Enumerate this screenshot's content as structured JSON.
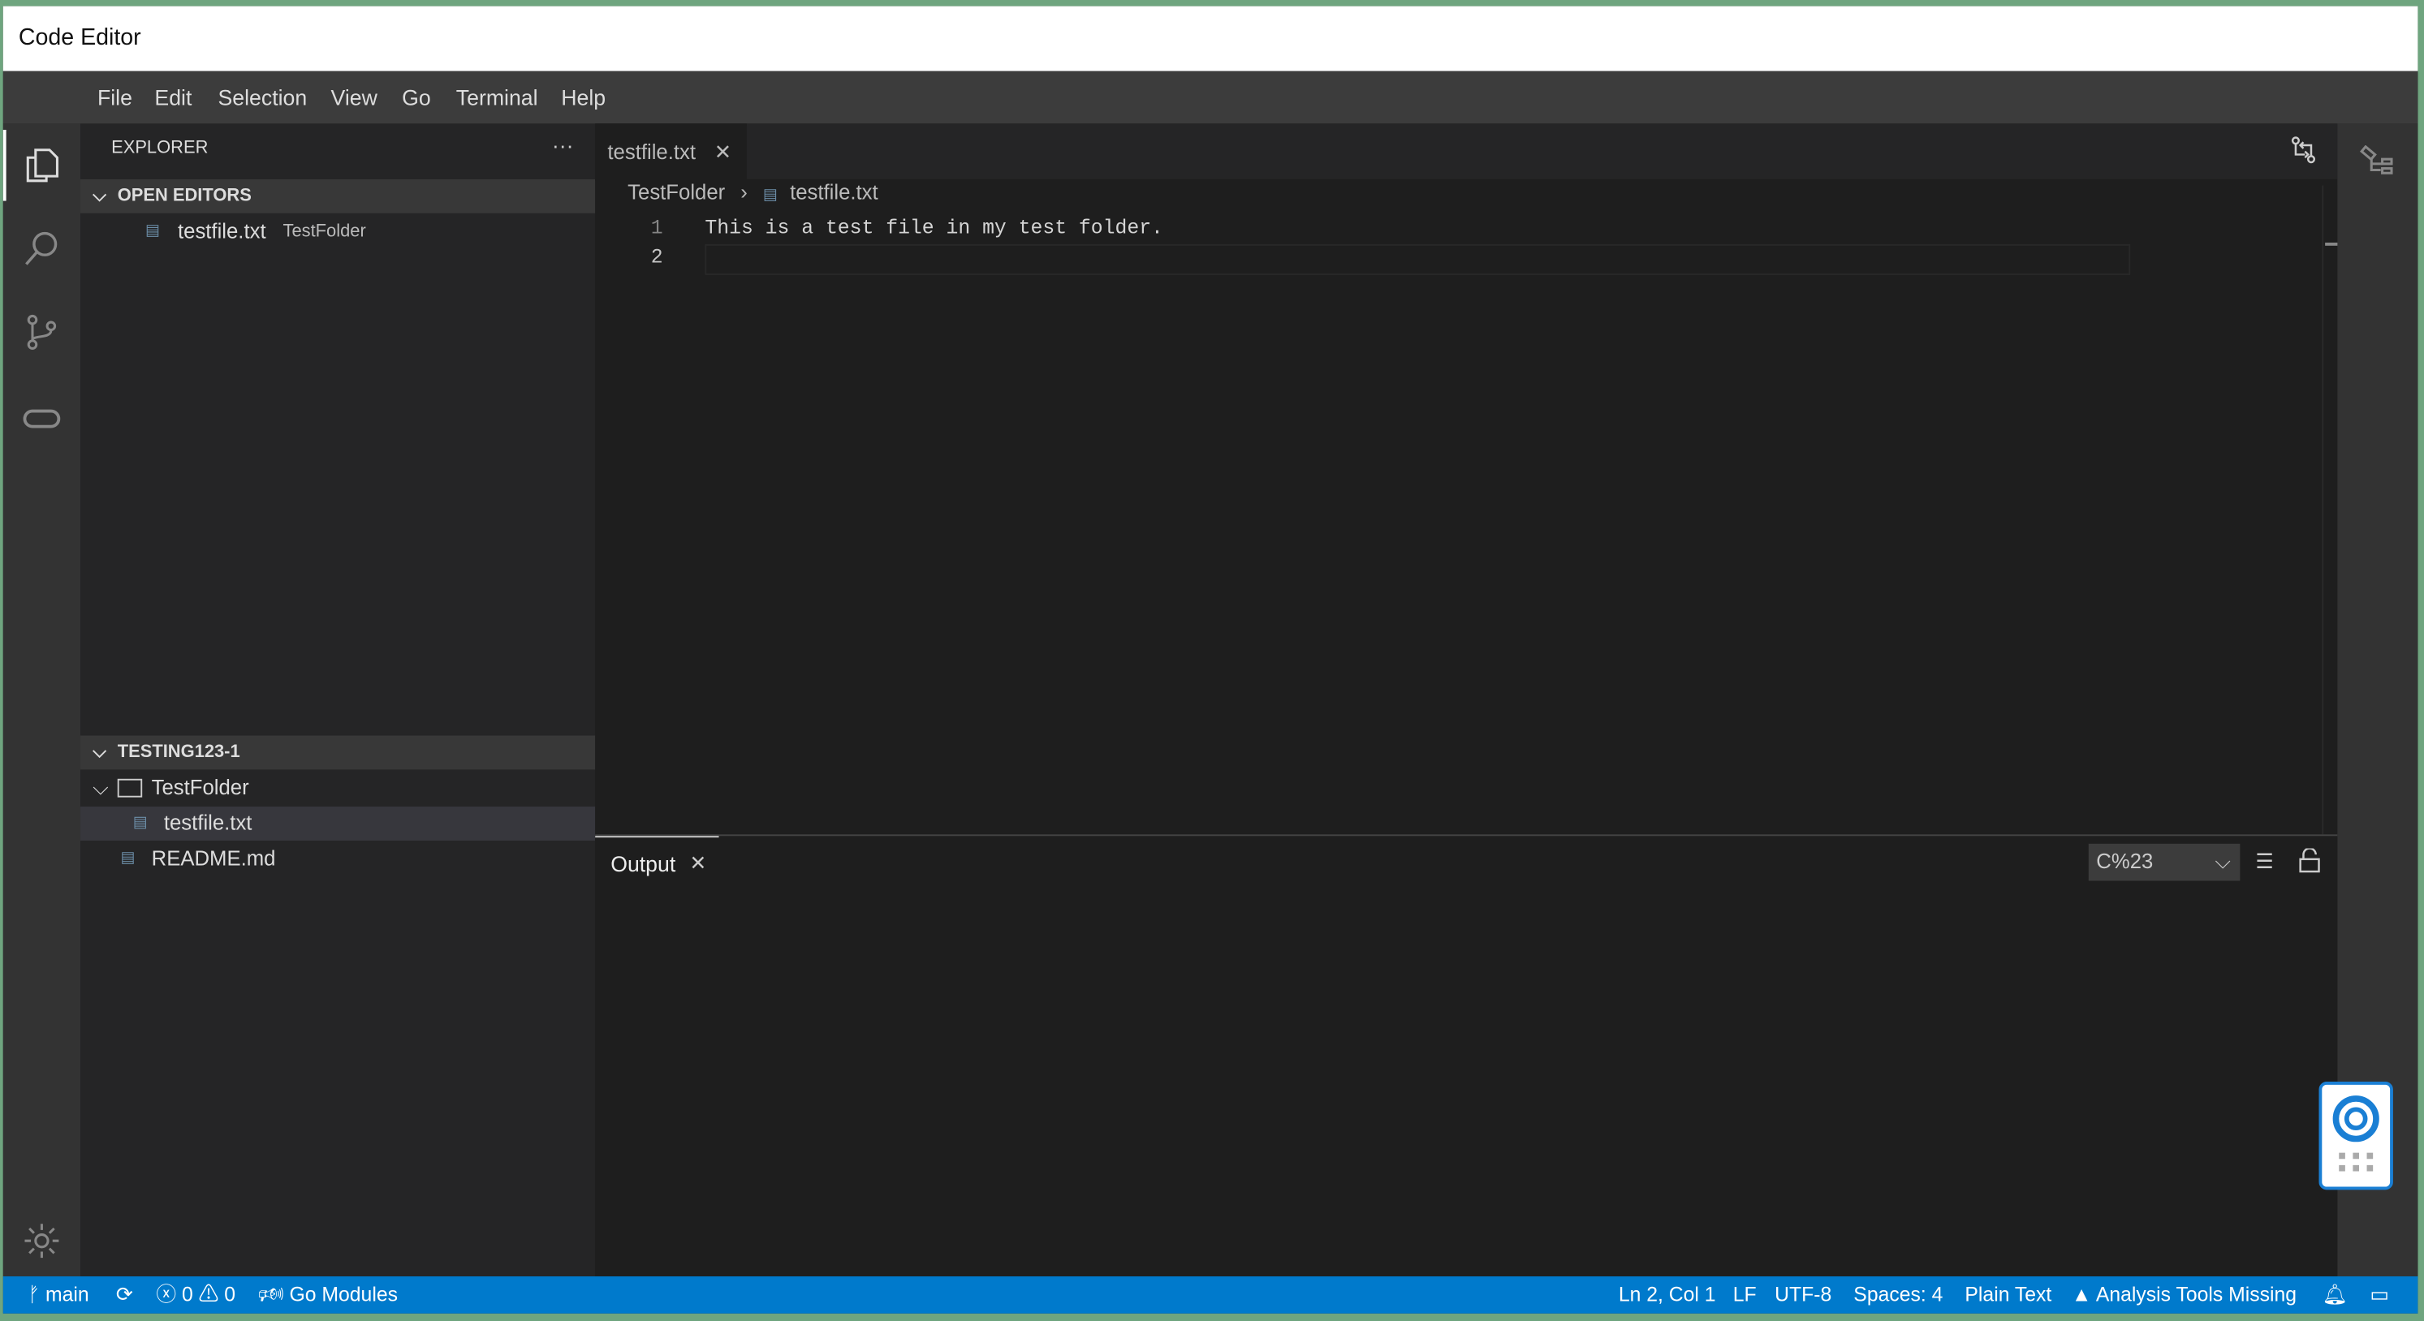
{
  "window": {
    "title": "Code Editor"
  },
  "menu": [
    "File",
    "Edit",
    "Selection",
    "View",
    "Go",
    "Terminal",
    "Help"
  ],
  "sidebar": {
    "title": "EXPLORER",
    "more": "···",
    "open_editors": {
      "label": "OPEN EDITORS",
      "items": [
        {
          "name": "testfile.txt",
          "folder": "TestFolder"
        }
      ]
    },
    "workspace": {
      "label": "TESTING123-1",
      "folder": "TestFolder",
      "file": "testfile.txt",
      "readme": "README.md"
    }
  },
  "editor": {
    "tab": "testfile.txt",
    "breadcrumb": [
      "TestFolder",
      "testfile.txt"
    ],
    "lines": [
      {
        "n": "1",
        "text": "This is a test file in my test folder."
      },
      {
        "n": "2",
        "text": ""
      }
    ]
  },
  "panel": {
    "tab": "Output",
    "select": "C%23"
  },
  "status": {
    "branch": "main",
    "errors": "0",
    "warnings": "0",
    "modules": "Go Modules",
    "position": "Ln 2, Col 1",
    "eol": "LF",
    "encoding": "UTF-8",
    "spaces": "Spaces: 4",
    "language": "Plain Text",
    "analysis": "Analysis Tools Missing"
  },
  "colors": {
    "status_bar": "#007acc",
    "accent": "#007acc"
  }
}
